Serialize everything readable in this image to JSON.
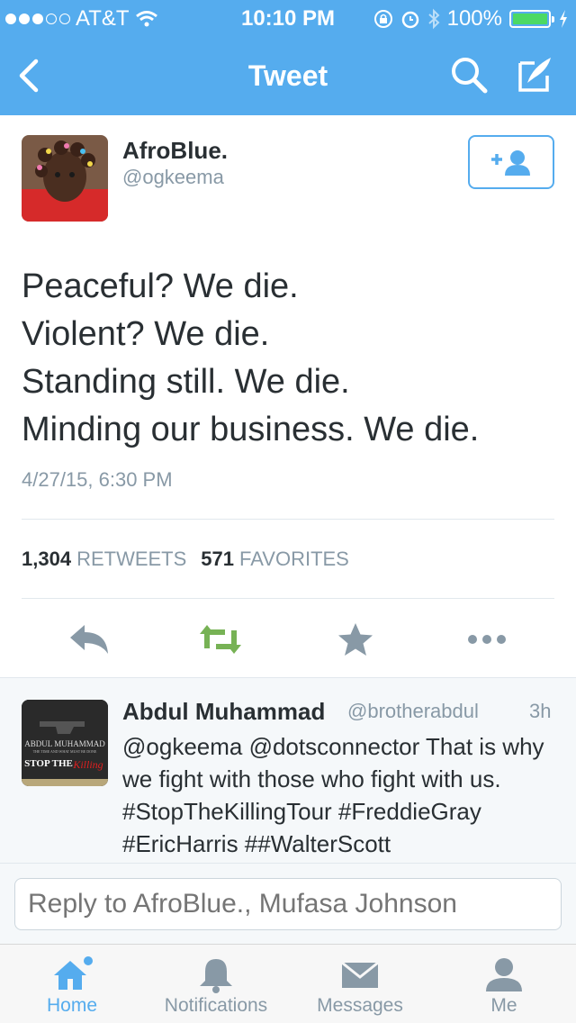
{
  "status_bar": {
    "carrier": "AT&T",
    "time": "10:10 PM",
    "battery": "100%"
  },
  "nav": {
    "title": "Tweet"
  },
  "tweet": {
    "author_name": "AfroBlue.",
    "author_handle": "@ogkeema",
    "lines": [
      "Peaceful? We die.",
      "Violent? We die.",
      "Standing still. We die.",
      "Minding our business. We die."
    ],
    "timestamp": "4/27/15, 6:30 PM",
    "retweets_count": "1,304",
    "retweets_label": "RETWEETS",
    "favorites_count": "571",
    "favorites_label": "FAVORITES"
  },
  "reply": {
    "author_name": "Abdul Muhammad",
    "author_handle": "@brotherabdul",
    "time": "3h",
    "text": "@ogkeema @dotsconnector That is why we fight with those who fight with us. #StopTheKillingTour #FreddieGray #EricHarris ##WalterScott",
    "avatar_text": [
      "ABDUL MUHAMMAD",
      "THE TIME AND WHAT MUST BE DONE",
      "STOP THE",
      "Killing"
    ]
  },
  "reply_input": {
    "placeholder": "Reply to AfroBlue., Mufasa Johnson"
  },
  "tabs": [
    {
      "label": "Home",
      "icon": "home-icon"
    },
    {
      "label": "Notifications",
      "icon": "bell-icon"
    },
    {
      "label": "Messages",
      "icon": "envelope-icon"
    },
    {
      "label": "Me",
      "icon": "person-icon"
    }
  ],
  "colors": {
    "accent": "#55acee",
    "retweet": "#77b255",
    "muted": "#8899a6"
  }
}
